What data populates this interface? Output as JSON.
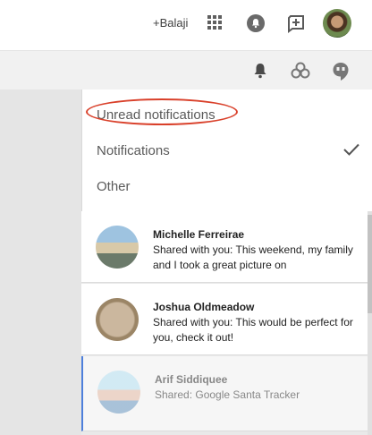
{
  "topbar": {
    "user_link": "+Balaji",
    "icons": {
      "apps": "apps-grid-icon",
      "notifications": "bell-icon",
      "share": "share-plus-icon",
      "avatar": "avatar"
    }
  },
  "subbar": {
    "icons": [
      "bell-icon",
      "circles-icon",
      "hangouts-icon"
    ]
  },
  "menu": {
    "items": [
      {
        "label": "Unread notifications",
        "highlighted": true
      },
      {
        "label": "Notifications",
        "checked": true
      },
      {
        "label": "Other"
      }
    ]
  },
  "notifications": [
    {
      "name": "Michelle Ferreirae",
      "body": "Shared with you: This weekend, my family and I took a great picture on",
      "read": false
    },
    {
      "name": "Joshua Oldmeadow",
      "body": "Shared with you: This would be perfect for you, check it out!",
      "read": false
    },
    {
      "name": "Arif Siddiquee",
      "body": "Shared: Google Santa Tracker",
      "read": true
    }
  ],
  "colors": {
    "highlight_circle": "#d9402a",
    "read_accent": "#4d7fdb"
  }
}
